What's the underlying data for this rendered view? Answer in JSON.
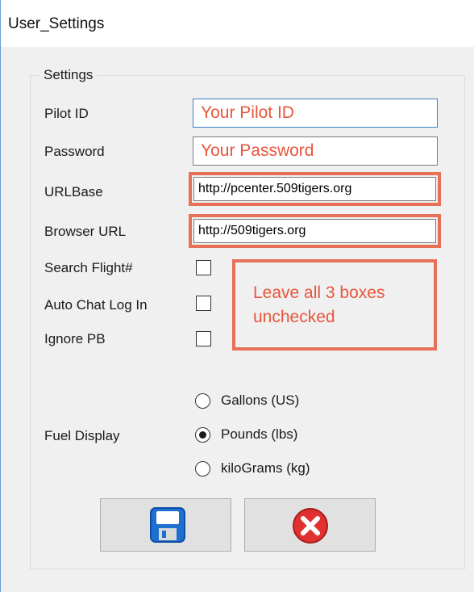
{
  "window": {
    "title": "User_Settings"
  },
  "group": {
    "legend": "Settings"
  },
  "fields": {
    "pilot_id": {
      "label": "Pilot ID",
      "value": "Your Pilot ID"
    },
    "password": {
      "label": "Password",
      "value": "Your Password"
    },
    "url_base": {
      "label": "URLBase",
      "value": "http://pcenter.509tigers.org"
    },
    "browser_url": {
      "label": "Browser URL",
      "value": "http://509tigers.org"
    }
  },
  "checkboxes": {
    "search_flight": {
      "label": "Search Flight#",
      "checked": false
    },
    "auto_chat": {
      "label": "Auto Chat Log In",
      "checked": false
    },
    "ignore_pb": {
      "label": "Ignore PB",
      "checked": false
    }
  },
  "annotation": {
    "text": "Leave all 3 boxes unchecked",
    "color": "#e8553b"
  },
  "fuel": {
    "label": "Fuel Display",
    "options": [
      "Gallons (US)",
      "Pounds (lbs)",
      "kiloGrams (kg)"
    ],
    "selected": "Pounds (lbs)"
  },
  "buttons": {
    "save_icon": "floppy-disk-icon",
    "cancel_icon": "red-x-icon"
  },
  "colors": {
    "highlight": "#e67058",
    "accent_blue": "#3b7fc4",
    "window_bg": "#f0f0f0"
  }
}
